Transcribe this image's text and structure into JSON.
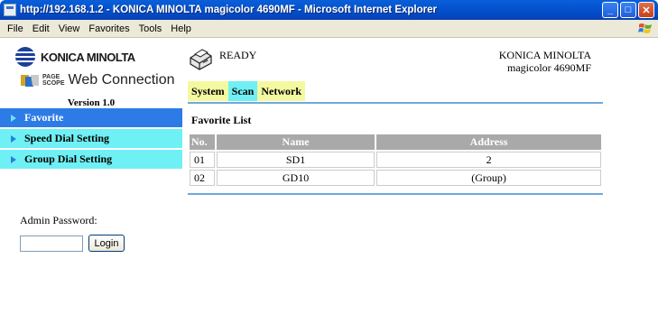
{
  "window": {
    "title": "http://192.168.1.2 - KONICA MINOLTA magicolor 4690MF - Microsoft Internet Explorer",
    "minimize": "_",
    "maximize": "□",
    "close": "✕"
  },
  "menubar": {
    "items": [
      "File",
      "Edit",
      "View",
      "Favorites",
      "Tools",
      "Help"
    ]
  },
  "branding": {
    "company": "KONICA MINOLTA",
    "pagescope_top": "PAGE",
    "pagescope_bottom": "SCOPE",
    "product": "Web Connection",
    "version": "Version 1.0"
  },
  "nav": {
    "items": [
      {
        "label": "Favorite",
        "active": true
      },
      {
        "label": "Speed Dial Setting",
        "active": false
      },
      {
        "label": "Group Dial Setting",
        "active": false
      }
    ]
  },
  "admin": {
    "label": "Admin Password:",
    "input_value": "",
    "login_label": "Login"
  },
  "status": {
    "text": "READY",
    "maker": "KONICA MINOLTA",
    "model": "magicolor 4690MF"
  },
  "tabs": {
    "system": "System",
    "scan": "Scan",
    "network": "Network"
  },
  "favorite_list": {
    "title": "Favorite List",
    "columns": [
      "No.",
      "Name",
      "Address"
    ],
    "rows": [
      [
        "01",
        "SD1",
        "2"
      ],
      [
        "02",
        "GD10",
        "(Group)"
      ]
    ]
  },
  "colors": {
    "titlebar": "#0453d0",
    "nav_active": "#2d7be6",
    "nav_item": "#6ff0f4",
    "tab_yellow": "#f4f9a0",
    "tab_cyan": "#6ff0f4",
    "table_header": "#a9a9a9",
    "divider": "#6fa8dc"
  },
  "icons": {
    "app": "ie-page-icon",
    "flag": "windows-flag-icon",
    "printer": "printer-icon",
    "logo": "konica-minolta-globe-icon"
  }
}
